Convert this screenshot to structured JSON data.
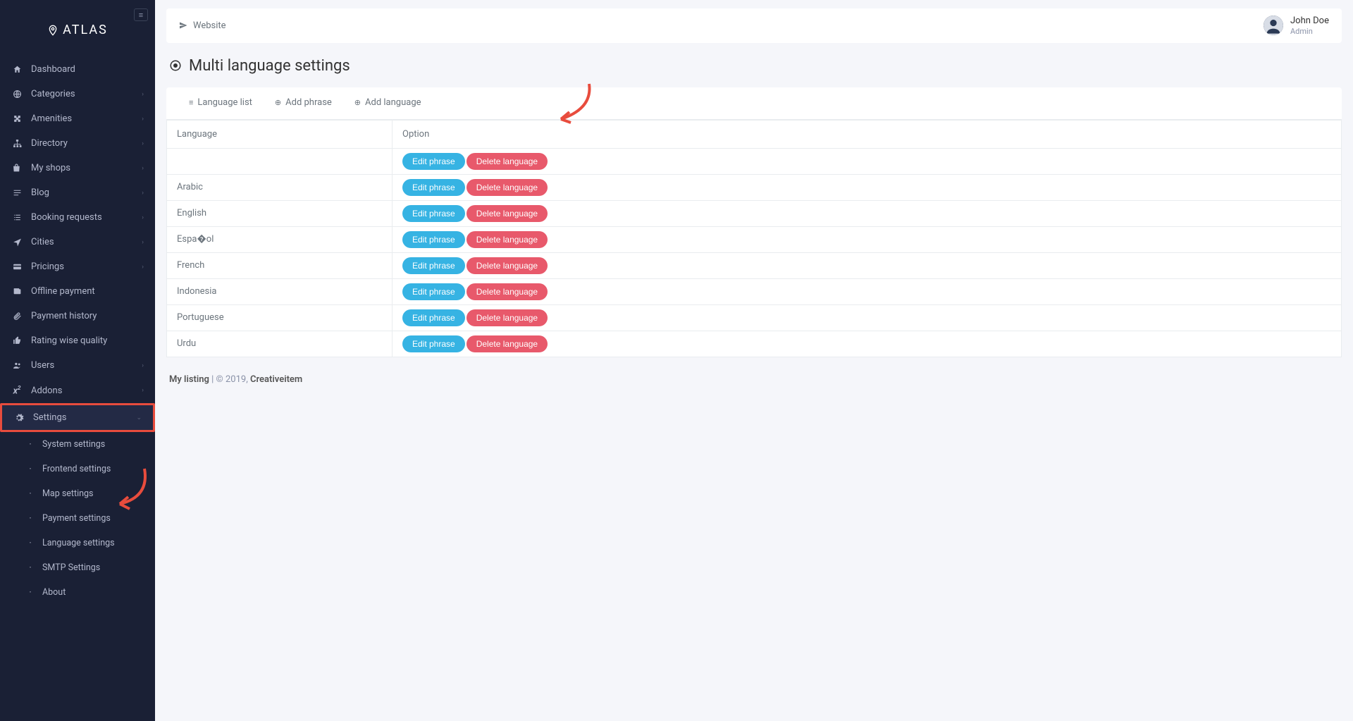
{
  "brand": "ATLAS",
  "topbar": {
    "website_label": "Website",
    "user_name": "John Doe",
    "user_role": "Admin"
  },
  "page_title": "Multi language settings",
  "nav": [
    {
      "label": "Dashboard",
      "icon": "home",
      "chevron": false
    },
    {
      "label": "Categories",
      "icon": "globe",
      "chevron": true
    },
    {
      "label": "Amenities",
      "icon": "puzzle",
      "chevron": true
    },
    {
      "label": "Directory",
      "icon": "sitemap",
      "chevron": true
    },
    {
      "label": "My shops",
      "icon": "bag",
      "chevron": true
    },
    {
      "label": "Blog",
      "icon": "lines",
      "chevron": true
    },
    {
      "label": "Booking requests",
      "icon": "list",
      "chevron": true
    },
    {
      "label": "Cities",
      "icon": "location",
      "chevron": true
    },
    {
      "label": "Pricings",
      "icon": "card",
      "chevron": true
    },
    {
      "label": "Offline payment",
      "icon": "wallet",
      "chevron": false
    },
    {
      "label": "Payment history",
      "icon": "clip",
      "chevron": false
    },
    {
      "label": "Rating wise quality",
      "icon": "thumb",
      "chevron": false
    },
    {
      "label": "Users",
      "icon": "users",
      "chevron": true
    },
    {
      "label": "Addons",
      "icon": "sup",
      "chevron": true
    },
    {
      "label": "Settings",
      "icon": "gear",
      "chevron": true,
      "active": true,
      "highlight": true
    }
  ],
  "settings_sub": [
    {
      "label": "System settings"
    },
    {
      "label": "Frontend settings"
    },
    {
      "label": "Map settings"
    },
    {
      "label": "Payment settings"
    },
    {
      "label": "Language settings"
    },
    {
      "label": "SMTP Settings"
    },
    {
      "label": "About"
    }
  ],
  "tabs": [
    {
      "label": "Language list",
      "icon": "≡"
    },
    {
      "label": "Add phrase",
      "icon": "+"
    },
    {
      "label": "Add language",
      "icon": "+"
    }
  ],
  "table": {
    "headers": {
      "col1": "Language",
      "col2": "Option"
    },
    "edit_label": "Edit phrase",
    "delete_label": "Delete language",
    "rows": [
      {
        "name": ""
      },
      {
        "name": "Arabic"
      },
      {
        "name": "English"
      },
      {
        "name": "Espa�ol"
      },
      {
        "name": "French"
      },
      {
        "name": "Indonesia"
      },
      {
        "name": "Portuguese"
      },
      {
        "name": "Urdu"
      }
    ]
  },
  "footer": {
    "brand": "My listing",
    "sep": " | ",
    "copyright": "© 2019, ",
    "credit": "Creativeitem"
  },
  "colors": {
    "sidebar_bg": "#1a2035",
    "accent_info": "#36b3e3",
    "accent_danger": "#e8596b",
    "highlight": "#e84c3d"
  }
}
